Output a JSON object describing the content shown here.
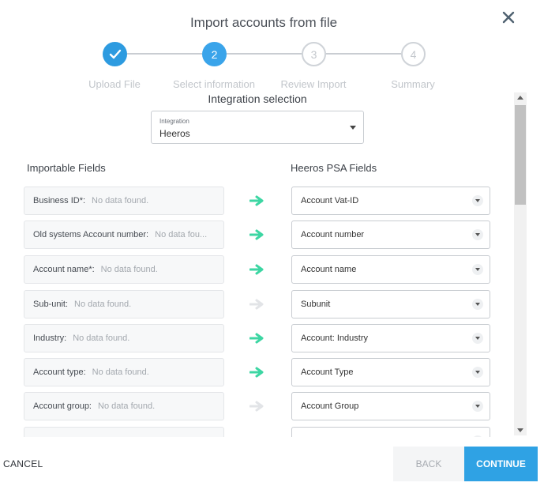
{
  "dialog": {
    "title": "Import accounts from file"
  },
  "steps": [
    {
      "number": "1",
      "label": "Upload File",
      "state": "done"
    },
    {
      "number": "2",
      "label": "Select information",
      "state": "active"
    },
    {
      "number": "3",
      "label": "Review Import",
      "state": "pending"
    },
    {
      "number": "4",
      "label": "Summary",
      "state": "pending"
    }
  ],
  "integration": {
    "section_title": "Integration selection",
    "field_label": "Integration",
    "value": "Heeros"
  },
  "columns": {
    "left": "Importable Fields",
    "right": "Heeros PSA Fields"
  },
  "mappings": [
    {
      "label": "Business ID*:",
      "value": "No data found.",
      "mapped": true,
      "target": "Account Vat-ID"
    },
    {
      "label": "Old systems Account number:",
      "value": "No data fou...",
      "mapped": true,
      "target": "Account number"
    },
    {
      "label": "Account name*:",
      "value": "No data found.",
      "mapped": true,
      "target": "Account name"
    },
    {
      "label": "Sub-unit:",
      "value": "No data found.",
      "mapped": false,
      "target": "Subunit"
    },
    {
      "label": "Industry:",
      "value": "No data found.",
      "mapped": true,
      "target": "Account: Industry"
    },
    {
      "label": "Account type:",
      "value": "No data found.",
      "mapped": true,
      "target": "Account Type"
    },
    {
      "label": "Account group:",
      "value": "No data found.",
      "mapped": false,
      "target": "Account Group"
    },
    {
      "label": "",
      "value": "",
      "mapped": false,
      "target": ""
    }
  ],
  "colors": {
    "accent": "#2fa2e4",
    "arrow_mapped": "#3dd6a3",
    "arrow_unmapped": "#e2e4e7"
  },
  "footer": {
    "cancel": "CANCEL",
    "back": "BACK",
    "continue": "CONTINUE"
  }
}
